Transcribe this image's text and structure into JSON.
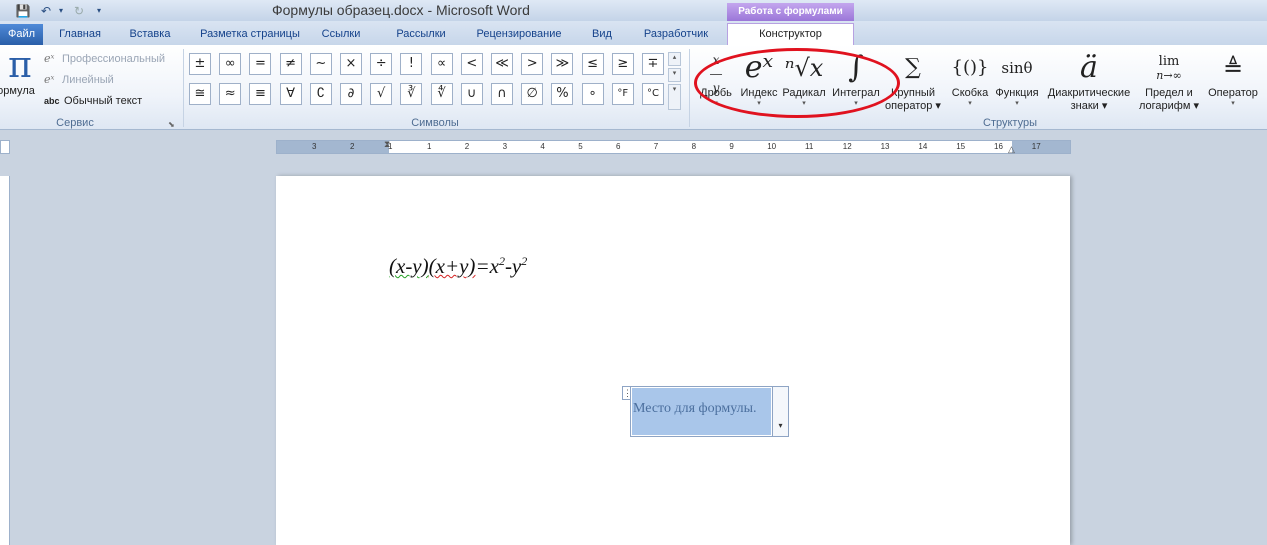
{
  "title_bar": {
    "title": "Формулы образец.docx - Microsoft Word",
    "context_header": "Работа с формулами"
  },
  "tabs": [
    {
      "label": "Файл"
    },
    {
      "label": "Главная"
    },
    {
      "label": "Вставка"
    },
    {
      "label": "Разметка страницы"
    },
    {
      "label": "Ссылки"
    },
    {
      "label": "Рассылки"
    },
    {
      "label": "Рецензирование"
    },
    {
      "label": "Вид"
    },
    {
      "label": "Разработчик"
    },
    {
      "label": "Конструктор"
    }
  ],
  "ribbon": {
    "service": {
      "group_label": "Сервис",
      "formula_label": "ормула",
      "professional": "Профессиональный",
      "linear": "Линейный",
      "normal_text": "Обычный текст",
      "normal_text_icon": "abc"
    },
    "symbols": {
      "group_label": "Символы",
      "row1": [
        "±",
        "∞",
        "=",
        "≠",
        "~",
        "×",
        "÷",
        "!",
        "∝",
        "<",
        "≪",
        ">",
        "≫",
        "≤",
        "≥",
        "∓"
      ],
      "row2": [
        "≅",
        "≈",
        "≡",
        "∀",
        "∁",
        "∂",
        "√",
        "∛",
        "∜",
        "∪",
        "∩",
        "∅",
        "%",
        "∘",
        "°F",
        "°C"
      ]
    },
    "structures": {
      "group_label": "Структуры",
      "items": [
        {
          "label": "Дробь",
          "label2": ""
        },
        {
          "label": "Индекс",
          "label2": ""
        },
        {
          "label": "Радикал",
          "label2": ""
        },
        {
          "label": "Интеграл",
          "label2": ""
        },
        {
          "label": "Крупный",
          "label2": "оператор"
        },
        {
          "label": "Скобка",
          "label2": ""
        },
        {
          "label": "Функция",
          "label2": ""
        },
        {
          "label": "Диакритические",
          "label2": "знаки"
        },
        {
          "label": "Предел и",
          "label2": "логарифм"
        },
        {
          "label": "Оператор",
          "label2": ""
        }
      ],
      "glyphs": {
        "fraction": "x/y",
        "index": "eˣ",
        "radical": "ⁿ√x",
        "integral": "∫",
        "large_operator": "∑",
        "bracket": "{()}",
        "function": "sinθ",
        "accent": "ä",
        "limit": "lim",
        "limit_sub": "n→∞",
        "operator": "≜"
      }
    }
  },
  "ruler": {
    "ticks": [
      "3",
      "2",
      "1",
      "1",
      "2",
      "3",
      "4",
      "5",
      "6",
      "7",
      "8",
      "9",
      "10",
      "11",
      "12",
      "13",
      "14",
      "15",
      "16",
      "17"
    ]
  },
  "document": {
    "equation": {
      "part1": "(x-y)",
      "part2": "(x+y)",
      "rest": "=x",
      "exp1": "2",
      "minus": "-y",
      "exp2": "2"
    },
    "placeholder": "Место для формулы."
  },
  "colors": {
    "accent": "#2a5ea8",
    "highlight_circle": "#e0121f",
    "context_tab": "#9b76d8"
  }
}
